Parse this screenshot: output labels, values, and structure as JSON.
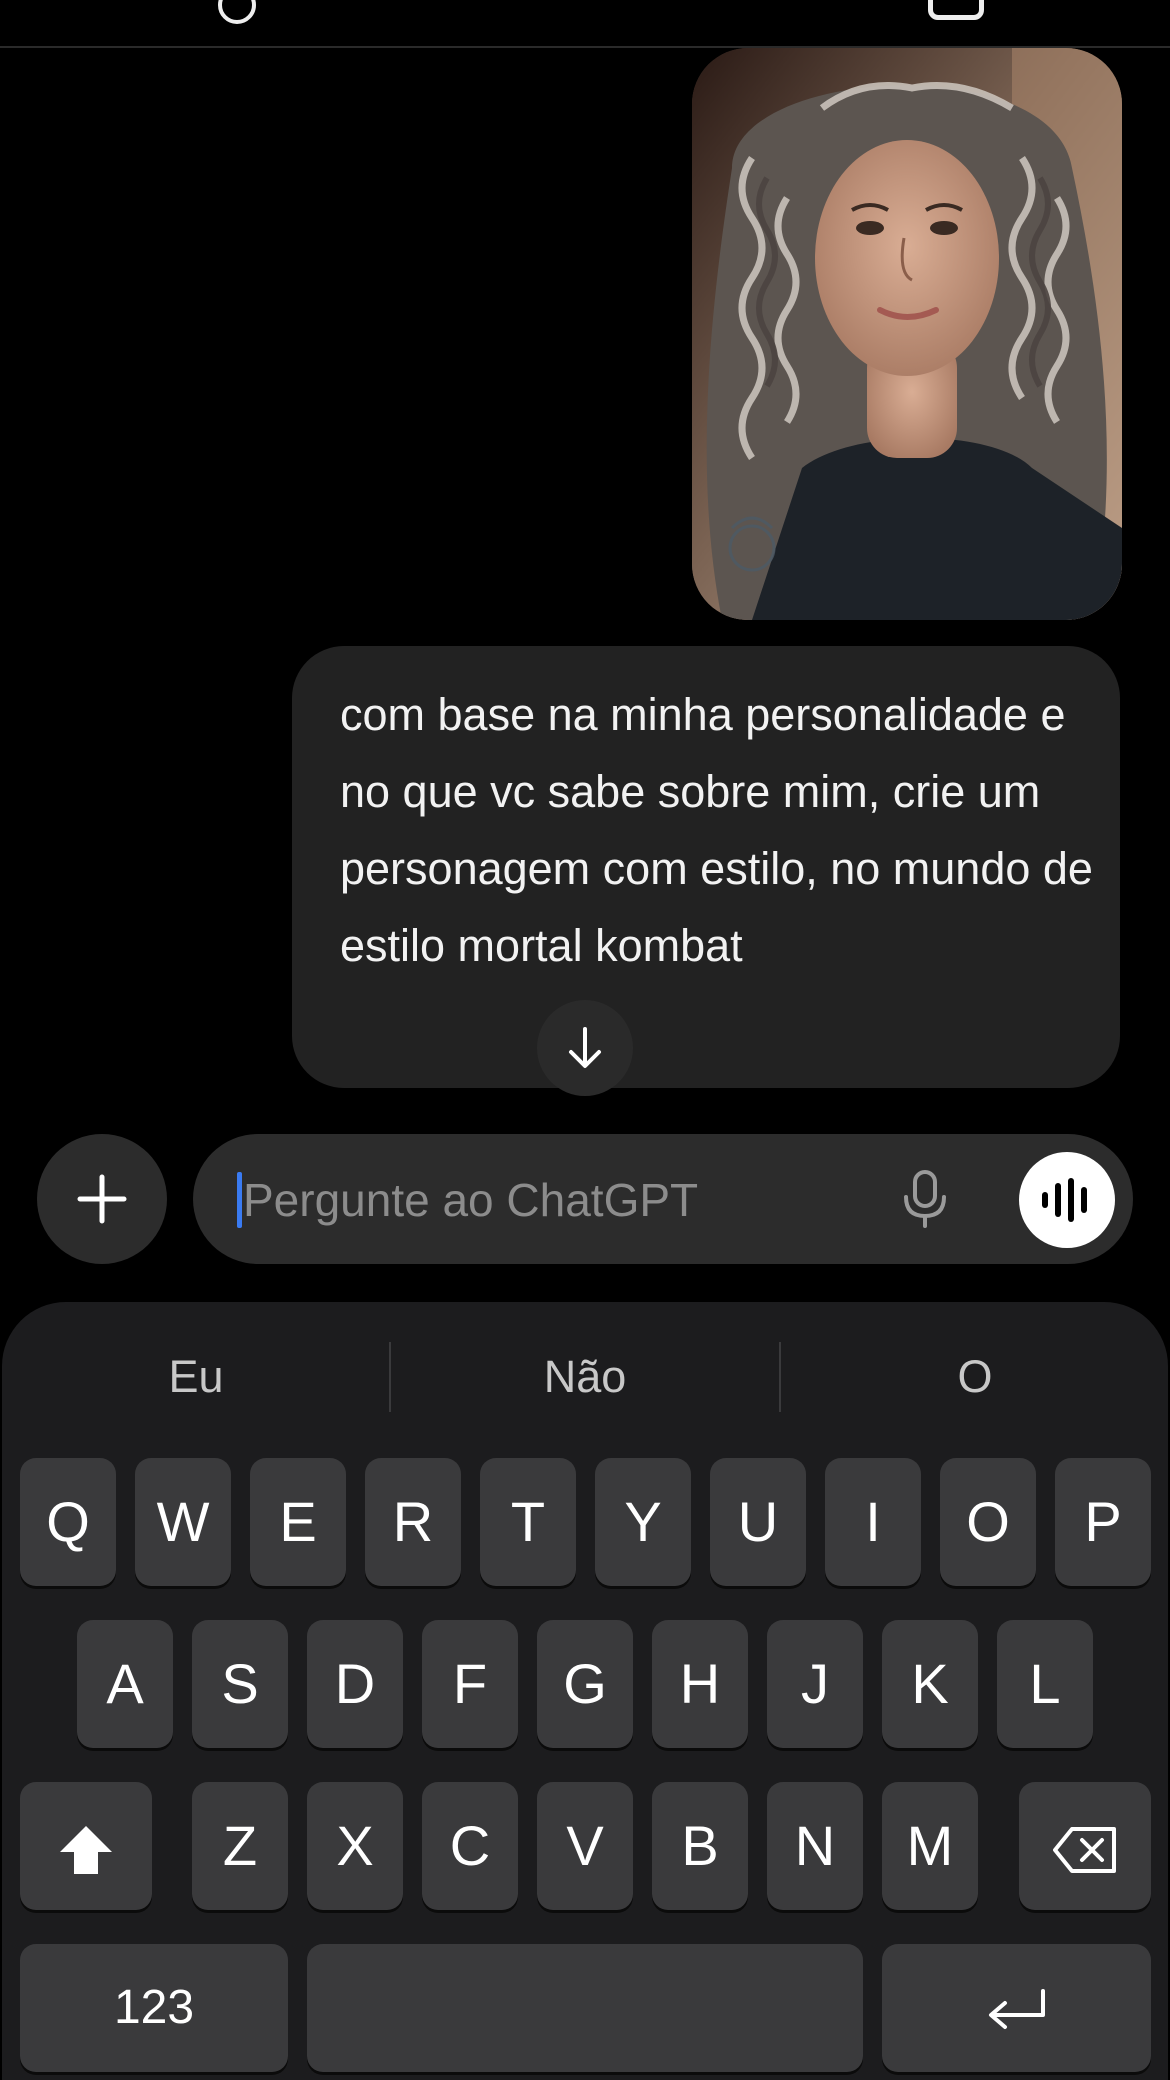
{
  "messages": {
    "photo_alt": "Foto enviada",
    "text": "com base na minha personalidade e no que vc sabe sobre mim, crie um personagem com estilo, no mundo de estilo mortal kombat"
  },
  "composer": {
    "placeholder": "Pergunte ao ChatGPT"
  },
  "keyboard": {
    "suggestions": [
      "Eu",
      "Não",
      "O"
    ],
    "row1": [
      "Q",
      "W",
      "E",
      "R",
      "T",
      "Y",
      "U",
      "I",
      "O",
      "P"
    ],
    "row2": [
      "A",
      "S",
      "D",
      "F",
      "G",
      "H",
      "J",
      "K",
      "L"
    ],
    "row3": [
      "Z",
      "X",
      "C",
      "V",
      "B",
      "N",
      "M"
    ],
    "numbers_label": "123"
  },
  "colors": {
    "background": "#000000",
    "bubble": "#222222",
    "key": "#3a3a3c",
    "keyboard": "#1c1c1e",
    "cursor": "#3a7bf2"
  }
}
